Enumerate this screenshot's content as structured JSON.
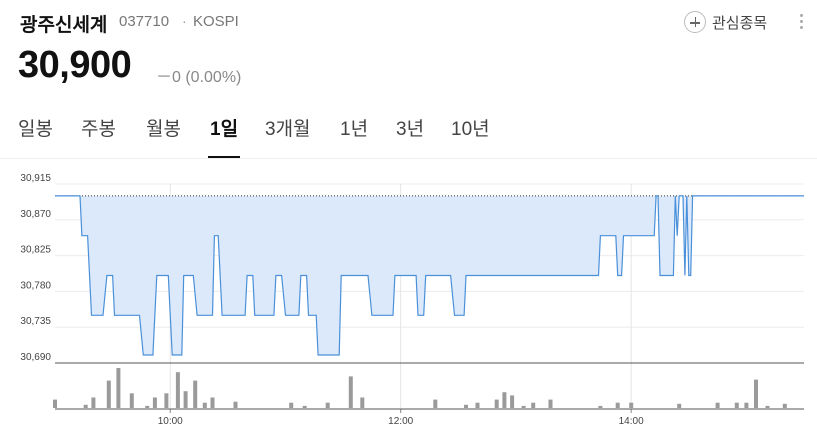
{
  "header": {
    "stock_name": "광주신세계",
    "stock_code": "037710",
    "separator": "·",
    "market": "KOSPI",
    "price": "30,900",
    "change": "－0 (0.00%)",
    "favorite_label": "관심종목"
  },
  "tabs": [
    {
      "label": "일봉",
      "active": false
    },
    {
      "label": "주봉",
      "active": false
    },
    {
      "label": "월봉",
      "active": false
    },
    {
      "label": "1일",
      "active": true
    },
    {
      "label": "3개월",
      "active": false
    },
    {
      "label": "1년",
      "active": false
    },
    {
      "label": "3년",
      "active": false
    },
    {
      "label": "10년",
      "active": false
    }
  ],
  "colors": {
    "line": "#4a90d9",
    "fill": "#dbe9fb",
    "volume": "#9a9a9a",
    "ref_line": "#333333"
  },
  "chart_data": {
    "type": "area",
    "y_ticks": [
      "30,915",
      "30,870",
      "30,825",
      "30,780",
      "30,735",
      "30,690"
    ],
    "ylim": [
      30690,
      30915
    ],
    "reference_price": 30900,
    "x_ticks": [
      "10:00",
      "12:00",
      "14:00"
    ],
    "xlim": [
      "09:00",
      "15:30"
    ],
    "price_series": [
      [
        "09:00",
        30900
      ],
      [
        "09:13",
        30900
      ],
      [
        "09:14",
        30850
      ],
      [
        "09:17",
        30850
      ],
      [
        "09:19",
        30750
      ],
      [
        "09:25",
        30750
      ],
      [
        "09:27",
        30800
      ],
      [
        "09:30",
        30800
      ],
      [
        "09:31",
        30750
      ],
      [
        "09:44",
        30750
      ],
      [
        "09:46",
        30700
      ],
      [
        "09:51",
        30700
      ],
      [
        "09:53",
        30800
      ],
      [
        "09:57",
        30800
      ],
      [
        "09:59",
        30800
      ],
      [
        "10:01",
        30700
      ],
      [
        "10:06",
        30700
      ],
      [
        "10:07",
        30800
      ],
      [
        "10:12",
        30800
      ],
      [
        "10:14",
        30750
      ],
      [
        "10:22",
        30750
      ],
      [
        "10:23",
        30850
      ],
      [
        "10:25",
        30850
      ],
      [
        "10:27",
        30750
      ],
      [
        "10:39",
        30750
      ],
      [
        "10:40",
        30800
      ],
      [
        "10:43",
        30800
      ],
      [
        "10:44",
        30750
      ],
      [
        "10:54",
        30750
      ],
      [
        "10:55",
        30800
      ],
      [
        "10:58",
        30800
      ],
      [
        "11:00",
        30750
      ],
      [
        "11:07",
        30750
      ],
      [
        "11:08",
        30800
      ],
      [
        "11:11",
        30800
      ],
      [
        "11:12",
        30750
      ],
      [
        "11:16",
        30750
      ],
      [
        "11:17",
        30700
      ],
      [
        "11:28",
        30700
      ],
      [
        "11:29",
        30800
      ],
      [
        "11:43",
        30800
      ],
      [
        "11:45",
        30750
      ],
      [
        "11:56",
        30750
      ],
      [
        "11:57",
        30800
      ],
      [
        "12:08",
        30800
      ],
      [
        "12:09",
        30750
      ],
      [
        "12:12",
        30750
      ],
      [
        "12:13",
        30800
      ],
      [
        "12:26",
        30800
      ],
      [
        "12:28",
        30750
      ],
      [
        "12:33",
        30750
      ],
      [
        "12:34",
        30800
      ],
      [
        "13:43",
        30800
      ],
      [
        "13:44",
        30850
      ],
      [
        "13:52",
        30850
      ],
      [
        "13:53",
        30800
      ],
      [
        "13:55",
        30800
      ],
      [
        "13:56",
        30850
      ],
      [
        "14:12",
        30850
      ],
      [
        "14:13",
        30900
      ],
      [
        "14:14",
        30900
      ],
      [
        "14:15",
        30800
      ],
      [
        "14:22",
        30800
      ],
      [
        "14:23",
        30900
      ],
      [
        "14:24",
        30850
      ],
      [
        "14:25",
        30900
      ],
      [
        "14:27",
        30900
      ],
      [
        "14:28",
        30800
      ],
      [
        "14:29",
        30900
      ],
      [
        "14:30",
        30800
      ],
      [
        "14:31",
        30800
      ],
      [
        "14:32",
        30900
      ],
      [
        "15:30",
        30900
      ]
    ],
    "volume_series": [
      [
        "09:00",
        8
      ],
      [
        "09:16",
        3
      ],
      [
        "09:20",
        10
      ],
      [
        "09:28",
        26
      ],
      [
        "09:33",
        38
      ],
      [
        "09:40",
        14
      ],
      [
        "09:48",
        2
      ],
      [
        "09:52",
        10
      ],
      [
        "09:58",
        14
      ],
      [
        "10:04",
        34
      ],
      [
        "10:08",
        16
      ],
      [
        "10:13",
        26
      ],
      [
        "10:18",
        5
      ],
      [
        "10:22",
        10
      ],
      [
        "10:34",
        6
      ],
      [
        "11:03",
        5
      ],
      [
        "11:10",
        2
      ],
      [
        "11:22",
        5
      ],
      [
        "11:34",
        30
      ],
      [
        "11:40",
        10
      ],
      [
        "12:18",
        8
      ],
      [
        "12:34",
        3
      ],
      [
        "12:40",
        5
      ],
      [
        "12:50",
        8
      ],
      [
        "12:54",
        15
      ],
      [
        "12:58",
        12
      ],
      [
        "13:04",
        2
      ],
      [
        "13:09",
        5
      ],
      [
        "13:18",
        8
      ],
      [
        "13:44",
        2
      ],
      [
        "13:53",
        5
      ],
      [
        "14:00",
        5
      ],
      [
        "14:25",
        4
      ],
      [
        "14:45",
        5
      ],
      [
        "14:55",
        5
      ],
      [
        "15:00",
        5
      ],
      [
        "15:05",
        27
      ],
      [
        "15:11",
        2
      ],
      [
        "15:20",
        4
      ]
    ]
  }
}
